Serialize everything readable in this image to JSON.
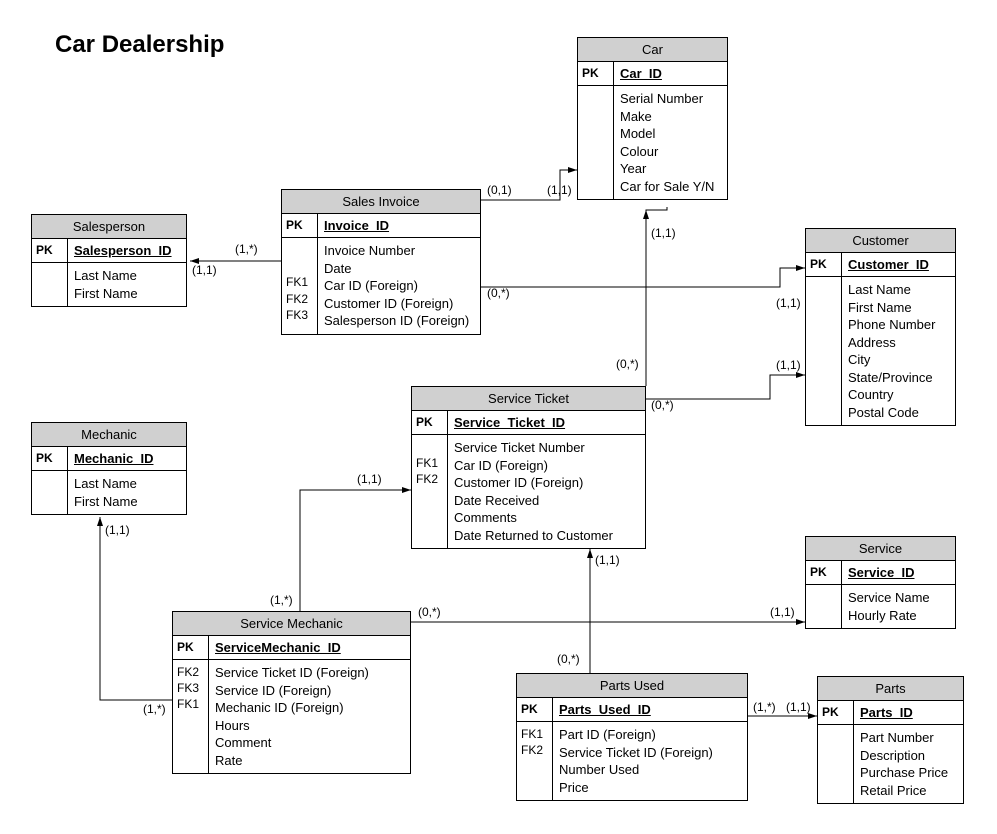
{
  "title": "Car Dealership",
  "entities": {
    "salesperson": {
      "name": "Salesperson",
      "pk": "Salesperson_ID",
      "attrs": [
        "Last Name",
        "First Name"
      ]
    },
    "salesInvoice": {
      "name": "Sales Invoice",
      "pk": "Invoice_ID",
      "rows": [
        {
          "key": "",
          "val": "Invoice Number"
        },
        {
          "key": "",
          "val": "Date"
        },
        {
          "key": "FK1",
          "val": "Car ID (Foreign)"
        },
        {
          "key": "FK2",
          "val": "Customer ID (Foreign)"
        },
        {
          "key": "FK3",
          "val": "Salesperson ID (Foreign)"
        }
      ]
    },
    "car": {
      "name": "Car",
      "pk": "Car_ID",
      "attrs": [
        "Serial Number",
        "Make",
        "Model",
        "Colour",
        "Year",
        "Car for Sale Y/N"
      ]
    },
    "customer": {
      "name": "Customer",
      "pk": "Customer_ID",
      "attrs": [
        "Last Name",
        "First Name",
        "Phone Number",
        "Address",
        "City",
        "State/Province",
        "Country",
        "Postal Code"
      ]
    },
    "mechanic": {
      "name": "Mechanic",
      "pk": "Mechanic_ID",
      "attrs": [
        "Last Name",
        "First Name"
      ]
    },
    "serviceTicket": {
      "name": "Service Ticket",
      "pk": "Service_Ticket_ID",
      "rows": [
        {
          "key": "",
          "val": "Service Ticket Number"
        },
        {
          "key": "FK1",
          "val": "Car ID (Foreign)"
        },
        {
          "key": "FK2",
          "val": "Customer ID (Foreign)"
        },
        {
          "key": "",
          "val": "Date Received"
        },
        {
          "key": "",
          "val": "Comments"
        },
        {
          "key": "",
          "val": "Date Returned to Customer"
        }
      ]
    },
    "service": {
      "name": "Service",
      "pk": "Service_ID",
      "attrs": [
        "Service Name",
        "Hourly Rate"
      ]
    },
    "serviceMechanic": {
      "name": "Service Mechanic",
      "pk": "ServiceMechanic_ID",
      "rows": [
        {
          "key": "FK2",
          "val": "Service Ticket ID (Foreign)"
        },
        {
          "key": "FK3",
          "val": "Service ID (Foreign)"
        },
        {
          "key": "FK1",
          "val": "Mechanic ID (Foreign)"
        },
        {
          "key": "",
          "val": "Hours"
        },
        {
          "key": "",
          "val": "Comment"
        },
        {
          "key": "",
          "val": "Rate"
        }
      ]
    },
    "partsUsed": {
      "name": "Parts Used",
      "pk": "Parts_Used_ID",
      "rows": [
        {
          "key": "FK1",
          "val": "Part ID (Foreign)"
        },
        {
          "key": "FK2",
          "val": "Service Ticket ID (Foreign)"
        },
        {
          "key": "",
          "val": "Number Used"
        },
        {
          "key": "",
          "val": "Price"
        }
      ]
    },
    "parts": {
      "name": "Parts",
      "pk": "Parts_ID",
      "attrs": [
        "Part Number",
        "Description",
        "Purchase Price",
        "Retail Price"
      ]
    }
  },
  "labels": {
    "pk": "PK"
  },
  "cardinalities": {
    "si_sp_a": "(1,*)",
    "si_sp_b": "(1,1)",
    "si_car_a": "(0,1)",
    "si_car_b": "(1,1)",
    "si_cust_a": "(0,*)",
    "si_cust_b": "(1,1)",
    "st_car_a": "(0,*)",
    "st_car_b": "(1,1)",
    "st_cust_a": "(0,*)",
    "st_cust_b": "(1,1)",
    "sm_st_a": "(1,*)",
    "sm_st_b": "(1,1)",
    "sm_mech_a": "(1,*)",
    "sm_mech_b": "(1,1)",
    "sm_svc_a": "(0,*)",
    "sm_svc_b": "(1,1)",
    "pu_st_a": "(0,*)",
    "pu_st_b": "(1,1)",
    "pu_parts_a": "(1,*)",
    "pu_parts_b": "(1,1)"
  }
}
